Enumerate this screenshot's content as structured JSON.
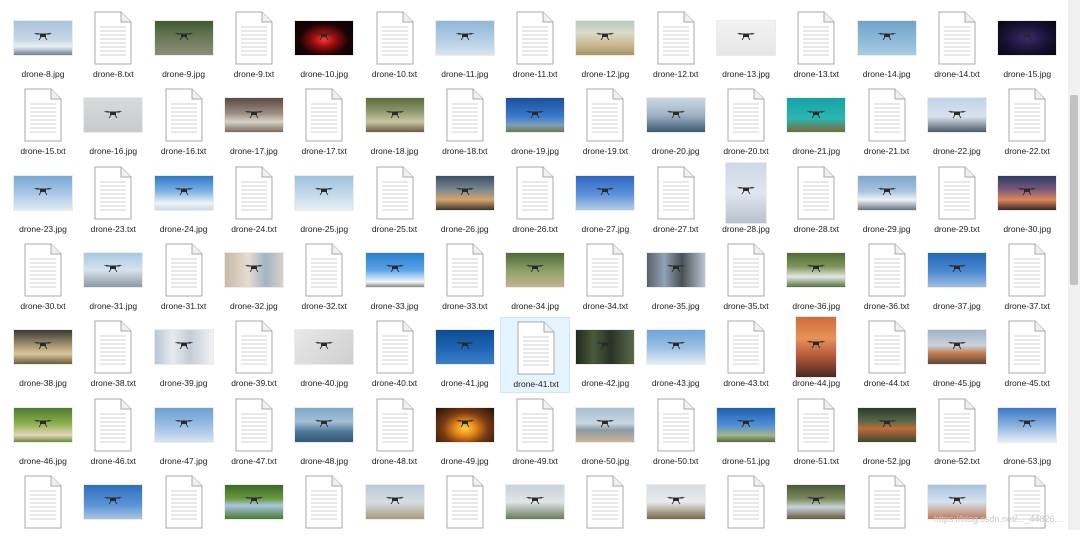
{
  "files": [
    {
      "name": "drone-8.jpg",
      "type": "jpg",
      "bg": "linear-gradient(180deg,#a7c3db 0%,#c8d8e6 55%,#e9eef3 75%,#6d8296 100%)"
    },
    {
      "name": "drone-8.txt",
      "type": "txt"
    },
    {
      "name": "drone-9.jpg",
      "type": "jpg",
      "bg": "linear-gradient(180deg,#3f5a2f 0%,#6a7a56 50%,#8d8d7a 100%)"
    },
    {
      "name": "drone-9.txt",
      "type": "txt"
    },
    {
      "name": "drone-10.jpg",
      "type": "jpg",
      "bg": "radial-gradient(ellipse at 50% 55%,#ff3b2f 0%,#a01010 25%,#1a0405 60%,#050202 100%)"
    },
    {
      "name": "drone-10.txt",
      "type": "txt"
    },
    {
      "name": "drone-11.jpg",
      "type": "jpg",
      "bg": "linear-gradient(180deg,#8fb6d9 0%,#b6d0e6 60%,#d9e4ee 100%)"
    },
    {
      "name": "drone-11.txt",
      "type": "txt"
    },
    {
      "name": "drone-12.jpg",
      "type": "jpg",
      "bg": "linear-gradient(180deg,#b8c9c2 0%,#d9dcc9 35%,#c9b98f 70%,#a89466 100%)"
    },
    {
      "name": "drone-12.txt",
      "type": "txt"
    },
    {
      "name": "drone-13.jpg",
      "type": "jpg",
      "bg": "linear-gradient(180deg,#f2f2f2 0%,#e6e6e6 100%)"
    },
    {
      "name": "drone-13.txt",
      "type": "txt"
    },
    {
      "name": "drone-14.jpg",
      "type": "jpg",
      "bg": "linear-gradient(180deg,#6fa3c9 0%,#8ebbd9 60%,#a9cce3 100%)"
    },
    {
      "name": "drone-14.txt",
      "type": "txt"
    },
    {
      "name": "drone-15.jpg",
      "type": "jpg",
      "bg": "radial-gradient(ellipse at 50% 50%,#3a2a6a 0%,#151030 60%,#07060f 100%)"
    },
    {
      "name": "drone-15.txt",
      "type": "txt"
    },
    {
      "name": "drone-16.jpg",
      "type": "jpg",
      "bg": "linear-gradient(180deg,#d8dadb 0%,#c7cacb 100%)"
    },
    {
      "name": "drone-16.txt",
      "type": "txt"
    },
    {
      "name": "drone-17.jpg",
      "type": "jpg",
      "bg": "linear-gradient(180deg,#5a4a44 0%,#9c8c80 45%,#d9d2c9 70%,#7a6b60 100%)"
    },
    {
      "name": "drone-17.txt",
      "type": "txt"
    },
    {
      "name": "drone-18.jpg",
      "type": "jpg",
      "bg": "linear-gradient(180deg,#5b6b3a 0%,#8e9a6e 40%,#c8c7a6 70%,#6b5d44 100%)"
    },
    {
      "name": "drone-18.txt",
      "type": "txt"
    },
    {
      "name": "drone-19.jpg",
      "type": "jpg",
      "bg": "linear-gradient(180deg,#1d4f9a 0%,#3a7bd0 55%,#7fa0b8 80%,#6b7a4a 100%)"
    },
    {
      "name": "drone-19.txt",
      "type": "txt"
    },
    {
      "name": "drone-20.jpg",
      "type": "jpg",
      "bg": "linear-gradient(180deg,#c9d7e2 0%,#9fb3c4 50%,#3e5a74 100%)"
    },
    {
      "name": "drone-20.txt",
      "type": "txt"
    },
    {
      "name": "drone-21.jpg",
      "type": "jpg",
      "bg": "linear-gradient(180deg,#16a3a6 0%,#2bb5b2 60%,#7a6a3a 100%)"
    },
    {
      "name": "drone-21.txt",
      "type": "txt"
    },
    {
      "name": "drone-22.jpg",
      "type": "jpg",
      "bg": "linear-gradient(180deg,#bfd4e8 0%,#d8e2ec 55%,#4f5b6a 100%)"
    },
    {
      "name": "drone-22.txt",
      "type": "txt"
    },
    {
      "name": "drone-23.jpg",
      "type": "jpg",
      "bg": "linear-gradient(180deg,#7aa8d6 0%,#a6c6e6 50%,#e1ebf3 100%)"
    },
    {
      "name": "drone-23.txt",
      "type": "txt"
    },
    {
      "name": "drone-24.jpg",
      "type": "jpg",
      "bg": "linear-gradient(180deg,#2f78c8 0%,#7fb1e3 45%,#eef3f8 80%,#cfd9e4 100%)"
    },
    {
      "name": "drone-24.txt",
      "type": "txt"
    },
    {
      "name": "drone-25.jpg",
      "type": "jpg",
      "bg": "linear-gradient(180deg,#9ec1dd 0%,#c9dceb 60%,#e6eef4 100%)"
    },
    {
      "name": "drone-25.txt",
      "type": "txt"
    },
    {
      "name": "drone-26.jpg",
      "type": "jpg",
      "bg": "linear-gradient(180deg,#3a4f66 0%,#7b8a8f 40%,#d6a46a 70%,#3a3530 100%)"
    },
    {
      "name": "drone-26.txt",
      "type": "txt"
    },
    {
      "name": "drone-27.jpg",
      "type": "jpg",
      "bg": "linear-gradient(180deg,#2f68c4 0%,#5d93dc 55%,#b4cbe3 100%)"
    },
    {
      "name": "drone-27.txt",
      "type": "txt"
    },
    {
      "name": "drone-28.jpg",
      "type": "jpg",
      "tall": true,
      "bg": "linear-gradient(180deg,#cdd8e6 0%,#dfe6ef 50%,#b7c2cd 100%)"
    },
    {
      "name": "drone-28.txt",
      "type": "txt"
    },
    {
      "name": "drone-29.jpg",
      "type": "jpg",
      "bg": "linear-gradient(180deg,#7ea6cf 0%,#a9c4de 45%,#eef2f6 70%,#6a7684 100%)"
    },
    {
      "name": "drone-29.txt",
      "type": "txt"
    },
    {
      "name": "drone-30.jpg",
      "type": "jpg",
      "bg": "linear-gradient(180deg,#2d3a66 0%,#7a5a7a 40%,#e0855a 70%,#3a2a2a 100%)"
    },
    {
      "name": "drone-30.txt",
      "type": "txt"
    },
    {
      "name": "drone-31.jpg",
      "type": "jpg",
      "bg": "linear-gradient(180deg,#a9c8e3 0%,#d6e2ec 50%,#8c9aa6 100%)"
    },
    {
      "name": "drone-31.txt",
      "type": "txt"
    },
    {
      "name": "drone-32.jpg",
      "type": "jpg",
      "bg": "linear-gradient(90deg,#c6b9a6 0%,#e6ddd0 40%,#9fb4c6 70%,#d8d2c8 100%)"
    },
    {
      "name": "drone-32.txt",
      "type": "txt"
    },
    {
      "name": "drone-33.jpg",
      "type": "jpg",
      "bg": "linear-gradient(180deg,#2a7fd0 0%,#5aa4e6 50%,#f2f6fa 85%,#8a8a7a 100%)"
    },
    {
      "name": "drone-33.txt",
      "type": "txt"
    },
    {
      "name": "drone-34.jpg",
      "type": "jpg",
      "bg": "linear-gradient(180deg,#4f6a3a 0%,#8aa066 50%,#c8b28c 100%)"
    },
    {
      "name": "drone-34.txt",
      "type": "txt"
    },
    {
      "name": "drone-35.jpg",
      "type": "jpg",
      "bg": "linear-gradient(90deg,#5b6068 0%,#8ea3b6 30%,#4a4f56 60%,#b9c7d3 100%)"
    },
    {
      "name": "drone-35.txt",
      "type": "txt"
    },
    {
      "name": "drone-36.jpg",
      "type": "jpg",
      "bg": "linear-gradient(180deg,#4f6b38 0%,#7d965a 40%,#e4e8e0 70%,#5a7040 100%)"
    },
    {
      "name": "drone-36.txt",
      "type": "txt"
    },
    {
      "name": "drone-37.jpg",
      "type": "jpg",
      "bg": "linear-gradient(180deg,#2367b8 0%,#4d8ad2 55%,#9ebee0 100%)"
    },
    {
      "name": "drone-37.txt",
      "type": "txt"
    },
    {
      "name": "drone-38.jpg",
      "type": "jpg",
      "bg": "linear-gradient(180deg,#3a3a33 0%,#9a8a6a 40%,#d9c79a 70%,#6a5a3a 100%)"
    },
    {
      "name": "drone-38.txt",
      "type": "txt"
    },
    {
      "name": "drone-39.jpg",
      "type": "jpg",
      "bg": "linear-gradient(90deg,#b8c7d6 0%,#e7eaee 30%,#c4ccd4 60%,#f0f2f5 100%)"
    },
    {
      "name": "drone-39.txt",
      "type": "txt"
    },
    {
      "name": "drone-40.jpg",
      "type": "jpg",
      "bg": "linear-gradient(135deg,#e8e8e8 0%,#d9d9d9 60%,#cfcfcf 100%)"
    },
    {
      "name": "drone-40.txt",
      "type": "txt"
    },
    {
      "name": "drone-41.jpg",
      "type": "jpg",
      "bg": "linear-gradient(180deg,#0d4c94 0%,#1f65b4 55%,#3b7fc8 100%)"
    },
    {
      "name": "drone-41.txt",
      "type": "txt",
      "selected": true
    },
    {
      "name": "drone-42.jpg",
      "type": "jpg",
      "bg": "linear-gradient(90deg,#1f2a1e 0%,#4a5a3a 30%,#2a3326 60%,#5a6a4a 100%)"
    },
    {
      "name": "drone-43.jpg",
      "type": "jpg",
      "bg": "linear-gradient(180deg,#6fa4d6 0%,#9ec3e6 55%,#e4edf5 100%)"
    },
    {
      "name": "drone-43.txt",
      "type": "txt"
    },
    {
      "name": "drone-44.jpg",
      "type": "jpg",
      "tall": true,
      "bg": "linear-gradient(180deg,#d06a3a 0%,#e8935a 35%,#b45a3a 65%,#4a2a22 100%)"
    },
    {
      "name": "drone-44.txt",
      "type": "txt"
    },
    {
      "name": "drone-45.jpg",
      "type": "jpg",
      "bg": "linear-gradient(180deg,#9fb3c6 0%,#c8d2dc 45%,#c47a4a 70%,#5a4a3a 100%)"
    },
    {
      "name": "drone-45.txt",
      "type": "txt"
    },
    {
      "name": "drone-46.jpg",
      "type": "jpg",
      "bg": "linear-gradient(180deg,#4f7a2f 0%,#8ab04a 45%,#e2d6b8 80%,#6a8a3a 100%)"
    },
    {
      "name": "drone-46.txt",
      "type": "txt"
    },
    {
      "name": "drone-47.jpg",
      "type": "jpg",
      "bg": "linear-gradient(180deg,#6e9fd2 0%,#a3c3e4 60%,#d7e4f0 100%)"
    },
    {
      "name": "drone-47.txt",
      "type": "txt"
    },
    {
      "name": "drone-48.jpg",
      "type": "jpg",
      "bg": "linear-gradient(180deg,#7fa8c9 0%,#a4c0d6 40%,#4f7896 70%,#2f5878 100%)"
    },
    {
      "name": "drone-48.txt",
      "type": "txt"
    },
    {
      "name": "drone-49.jpg",
      "type": "jpg",
      "bg": "radial-gradient(ellipse at 50% 60%,#ffd34a 0%,#e88a1a 25%,#7a3a12 55%,#1f1208 100%)"
    },
    {
      "name": "drone-49.txt",
      "type": "txt"
    },
    {
      "name": "drone-50.jpg",
      "type": "jpg",
      "bg": "linear-gradient(180deg,#a8bfd2 0%,#c9d6e0 45%,#8c9aa6 65%,#c8b696 100%)"
    },
    {
      "name": "drone-50.txt",
      "type": "txt"
    },
    {
      "name": "drone-51.jpg",
      "type": "jpg",
      "bg": "linear-gradient(180deg,#1f5fb0 0%,#4f8fd6 50%,#a3b58a 80%,#5a6a3a 100%)"
    },
    {
      "name": "drone-51.txt",
      "type": "txt"
    },
    {
      "name": "drone-52.jpg",
      "type": "jpg",
      "bg": "linear-gradient(180deg,#2f3a2a 0%,#5a6a4a 40%,#c46a3a 60%,#3a4a2e 100%)"
    },
    {
      "name": "drone-52.txt",
      "type": "txt"
    },
    {
      "name": "drone-53.jpg",
      "type": "jpg",
      "bg": "linear-gradient(180deg,#3d7ac4 0%,#87b1de 50%,#e6eef6 100%)"
    },
    {
      "name": "",
      "type": "txt"
    },
    {
      "name": "",
      "type": "jpg",
      "bg": "linear-gradient(180deg,#2f6fc0 0%,#5c95d6 60%,#a9c6e4 100%)"
    },
    {
      "name": "",
      "type": "txt"
    },
    {
      "name": "",
      "type": "jpg",
      "bg": "linear-gradient(180deg,#3a6a2a 0%,#6a9a3a 40%,#a8c6e2 60%,#4a7a30 100%)"
    },
    {
      "name": "",
      "type": "txt"
    },
    {
      "name": "",
      "type": "jpg",
      "bg": "linear-gradient(180deg,#b9c9d8 0%,#d6dde4 50%,#a89a7a 100%)"
    },
    {
      "name": "",
      "type": "txt"
    },
    {
      "name": "",
      "type": "jpg",
      "bg": "linear-gradient(180deg,#c8d2da 0%,#e0e4e8 50%,#6a7a5a 100%)"
    },
    {
      "name": "",
      "type": "txt"
    },
    {
      "name": "",
      "type": "jpg",
      "bg": "linear-gradient(180deg,#d8dde2 0%,#e8eaec 50%,#7a6a4a 100%)"
    },
    {
      "name": "",
      "type": "txt"
    },
    {
      "name": "",
      "type": "jpg",
      "bg": "linear-gradient(180deg,#4a5a3a 0%,#7a8a5a 40%,#c8d2da 65%,#6a5a3a 100%)"
    },
    {
      "name": "",
      "type": "txt"
    },
    {
      "name": "",
      "type": "jpg",
      "bg": "linear-gradient(180deg,#a8c4e2 0%,#d6e2ee 50%,#c07a5a 100%)"
    },
    {
      "name": "",
      "type": "txt"
    }
  ],
  "watermark": "https://blog.csdn.net/..._44826..."
}
